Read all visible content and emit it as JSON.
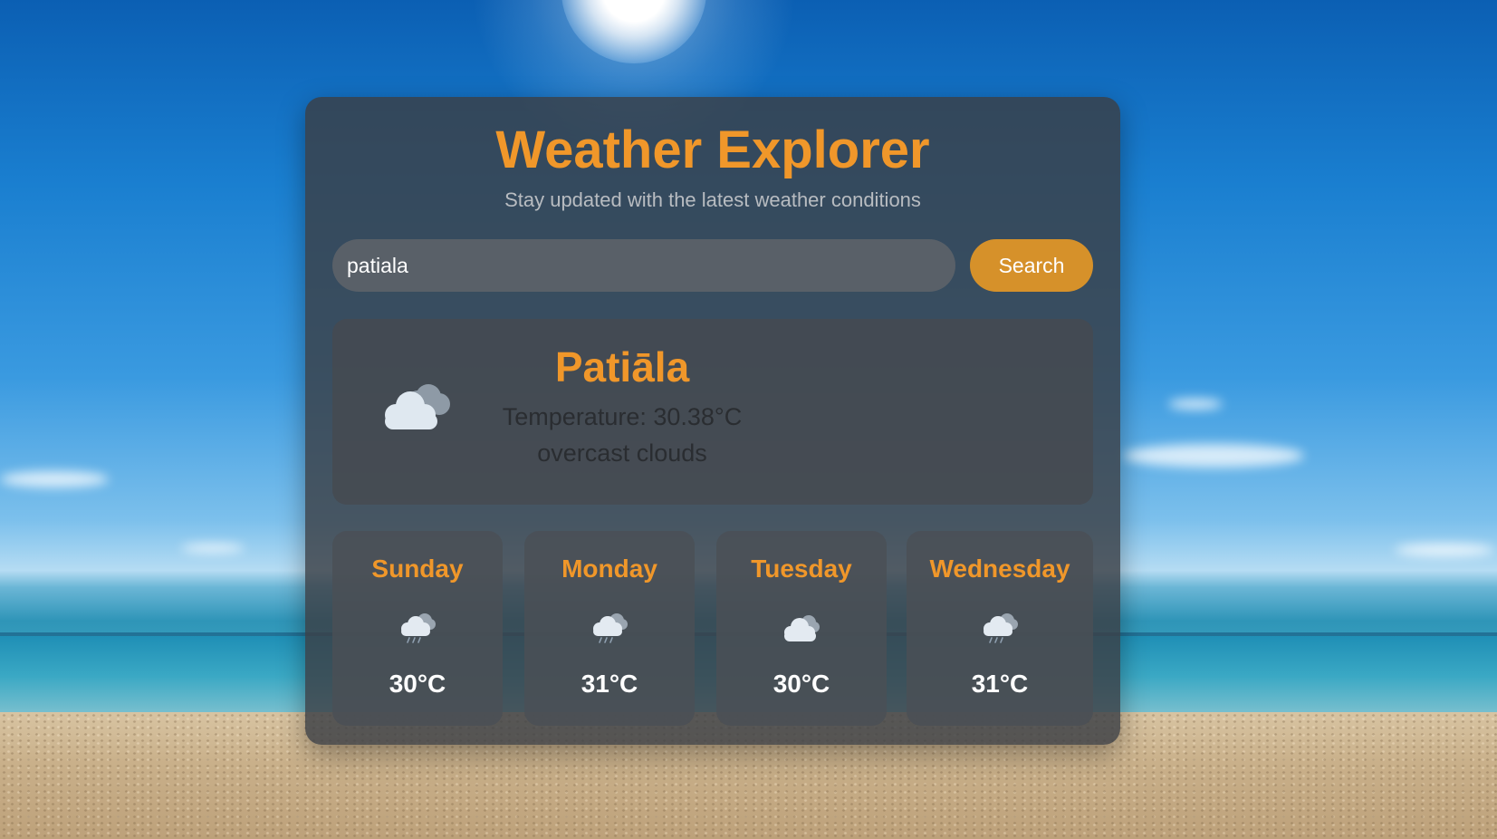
{
  "app": {
    "title": "Weather Explorer",
    "subtitle": "Stay updated with the latest weather conditions"
  },
  "search": {
    "value": "patiala",
    "button_label": "Search"
  },
  "current": {
    "city": "Patiāla",
    "temperature": "Temperature: 30.38°C",
    "description": "overcast clouds",
    "icon": "overcast-cloud-icon"
  },
  "forecast": [
    {
      "day": "Sunday",
      "temp": "30°C",
      "icon": "rain-cloud-icon"
    },
    {
      "day": "Monday",
      "temp": "31°C",
      "icon": "rain-cloud-icon"
    },
    {
      "day": "Tuesday",
      "temp": "30°C",
      "icon": "cloud-icon"
    },
    {
      "day": "Wednesday",
      "temp": "31°C",
      "icon": "rain-cloud-icon"
    }
  ],
  "colors": {
    "accent": "#f0972a",
    "button": "#d6912a",
    "card": "#3a3e44"
  }
}
